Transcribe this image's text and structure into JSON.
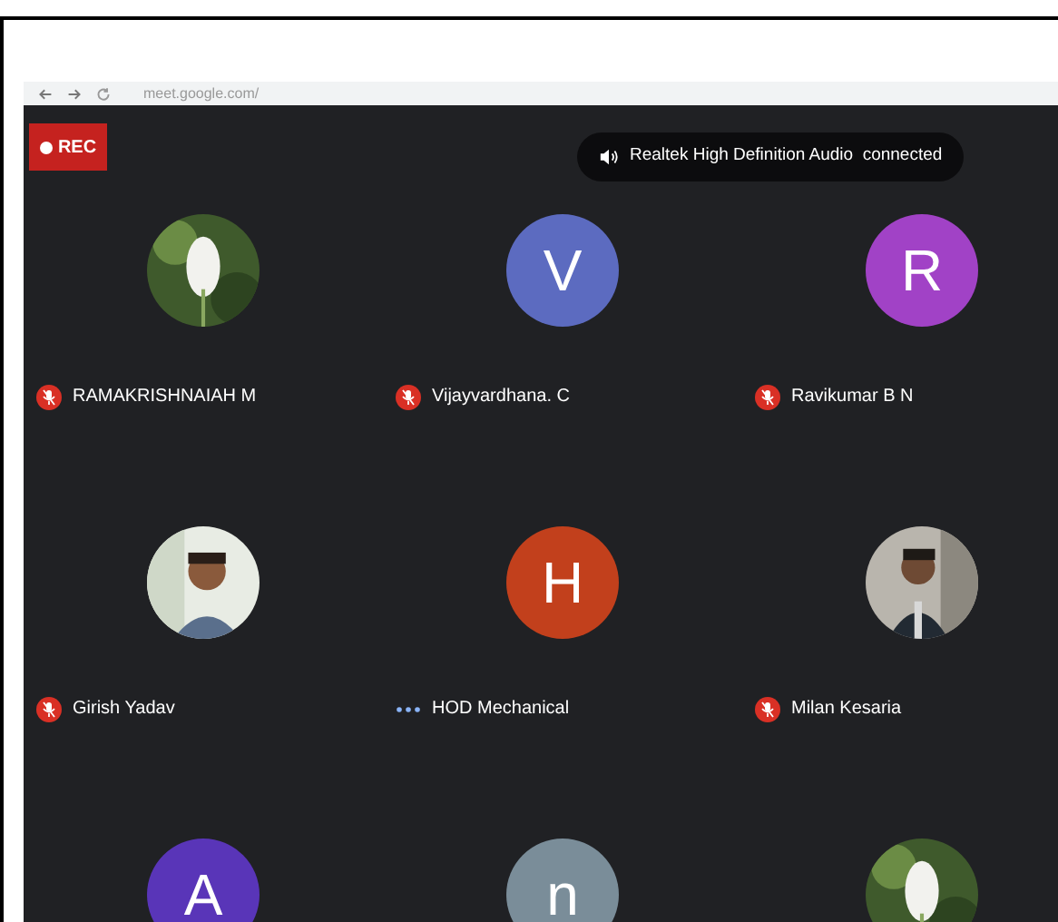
{
  "browser": {
    "url": "meet.google.com/"
  },
  "recording": {
    "label": "REC"
  },
  "toast": {
    "text": "Realtek High Definition Audio  connected"
  },
  "participants": [
    {
      "name": "RAMAKRISHNAIAH M",
      "kind": "picture",
      "muted": true
    },
    {
      "name": "Vijayvardhana. C",
      "kind": "letter",
      "initial": "V",
      "color": "#5c6bc0",
      "muted": true
    },
    {
      "name": "Ravikumar B N",
      "kind": "letter",
      "initial": "R",
      "color": "#a142c6",
      "muted": true
    },
    {
      "name": "Girish Yadav",
      "kind": "picture",
      "muted": true
    },
    {
      "name": "HOD Mechanical",
      "kind": "letter",
      "initial": "H",
      "color": "#c2401c",
      "muted": false
    },
    {
      "name": "Milan Kesaria",
      "kind": "picture",
      "muted": true
    },
    {
      "kind": "letter",
      "initial": "A",
      "color": "#5935b8"
    },
    {
      "kind": "letter",
      "initial": "n",
      "color": "#7a8d99"
    },
    {
      "kind": "picture"
    }
  ]
}
